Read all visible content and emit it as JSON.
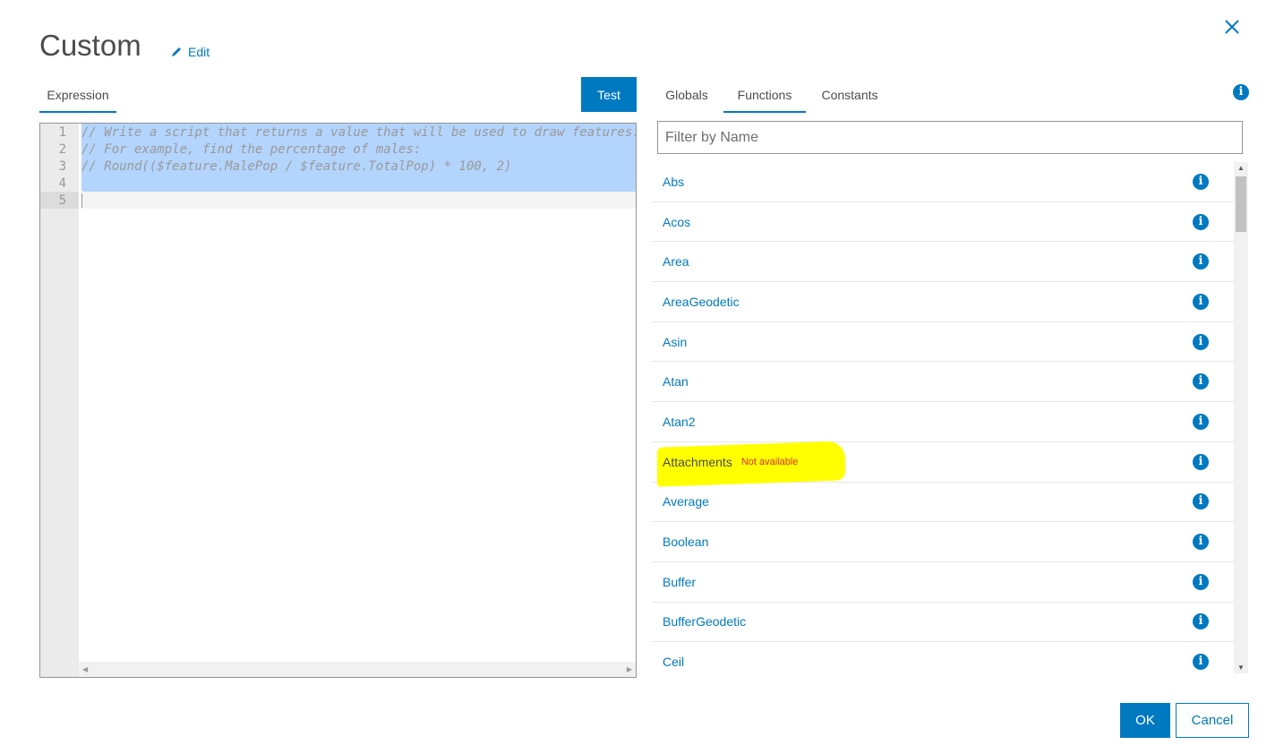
{
  "header": {
    "title": "Custom",
    "edit_label": "Edit"
  },
  "editor": {
    "tab": "Expression",
    "test_label": "Test",
    "lines": [
      "// Write a script that returns a value that will be used to draw features.",
      "// For example, find the percentage of males:",
      "// Round(($feature.MalePop / $feature.TotalPop) * 100, 2)",
      "",
      ""
    ],
    "line_numbers": [
      "1",
      "2",
      "3",
      "4",
      "5"
    ]
  },
  "panel": {
    "tabs": [
      "Globals",
      "Functions",
      "Constants"
    ],
    "active_tab": "Functions",
    "filter_placeholder": "Filter by Name",
    "functions": [
      {
        "name": "Abs"
      },
      {
        "name": "Acos"
      },
      {
        "name": "Area"
      },
      {
        "name": "AreaGeodetic"
      },
      {
        "name": "Asin"
      },
      {
        "name": "Atan"
      },
      {
        "name": "Atan2"
      },
      {
        "name": "Attachments",
        "note": "Not available"
      },
      {
        "name": "Average"
      },
      {
        "name": "Boolean"
      },
      {
        "name": "Buffer"
      },
      {
        "name": "BufferGeodetic"
      },
      {
        "name": "Ceil"
      }
    ]
  },
  "footer": {
    "ok_label": "OK",
    "cancel_label": "Cancel"
  },
  "colors": {
    "accent": "#0079c1",
    "highlight": "#ffff00",
    "warning": "#d83020"
  }
}
